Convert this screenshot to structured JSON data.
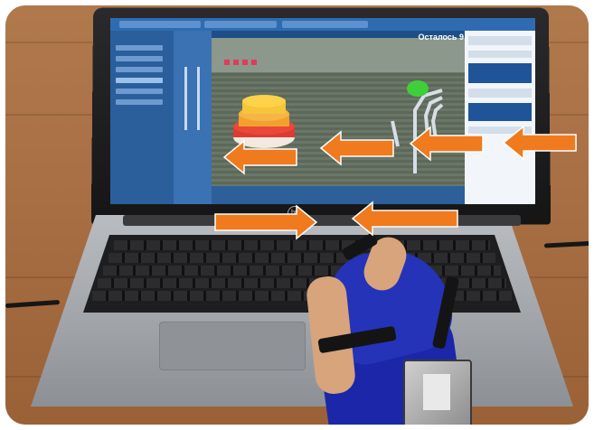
{
  "screen": {
    "timer_text": "Осталось 9 сек",
    "hp_logo": "hp"
  },
  "colors": {
    "arrow": "#f07a1e",
    "glove": "#2433b8",
    "screen_ui": "#1d4f86",
    "game_ring_top": "#ffd24a",
    "game_ring_mid": "#f2a12d",
    "game_ring_low": "#dd3b2f",
    "game_target": "#3ecf3a"
  },
  "arrows": {
    "count": 6,
    "direction": "left",
    "icon": "left-arrow-icon"
  }
}
